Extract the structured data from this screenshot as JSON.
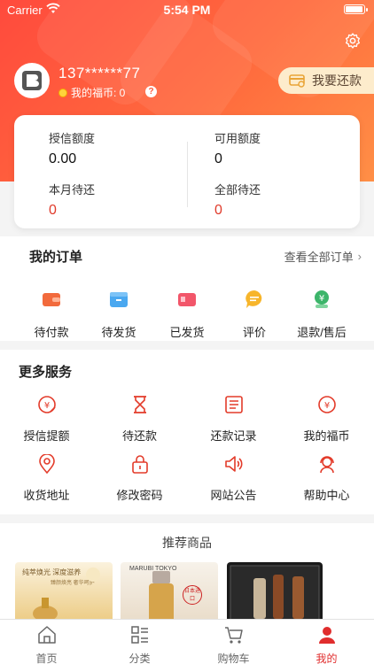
{
  "status_bar": {
    "carrier": "Carrier",
    "time": "5:54 PM"
  },
  "profile": {
    "phone": "137******77",
    "coins_label": "我的福币: 0",
    "help": "?"
  },
  "repay_button": "我要还款",
  "credit": {
    "credit_limit_label": "授信额度",
    "credit_limit_value": "0.00",
    "available_label": "可用额度",
    "available_value": "0",
    "month_due_label": "本月待还",
    "month_due_value": "0",
    "total_due_label": "全部待还",
    "total_due_value": "0"
  },
  "orders": {
    "title": "我的订单",
    "view_all": "查看全部订单",
    "items": [
      {
        "label": "待付款",
        "icon": "wallet-icon"
      },
      {
        "label": "待发货",
        "icon": "box-icon"
      },
      {
        "label": "已发货",
        "icon": "truck-icon"
      },
      {
        "label": "评价",
        "icon": "chat-icon"
      },
      {
        "label": "退款/售后",
        "icon": "refund-icon"
      }
    ]
  },
  "services": {
    "title": "更多服务",
    "items": [
      {
        "label": "授信提额",
        "icon": "credit-up-icon"
      },
      {
        "label": "待还款",
        "icon": "hourglass-icon"
      },
      {
        "label": "还款记录",
        "icon": "record-icon"
      },
      {
        "label": "我的福币",
        "icon": "yuan-coin-icon"
      },
      {
        "label": "收货地址",
        "icon": "location-icon"
      },
      {
        "label": "修改密码",
        "icon": "lock-icon"
      },
      {
        "label": "网站公告",
        "icon": "speaker-icon"
      },
      {
        "label": "帮助中心",
        "icon": "help-agent-icon"
      }
    ]
  },
  "recommend": {
    "title": "推荐商品",
    "p1_line1": "纯萃焕光 深度滋养",
    "p1_line2": "臻颜焕亮 奢华呵护",
    "p2_brand": "MARUBI TOKYO",
    "p2_stamp": "日本进口"
  },
  "tabbar": [
    {
      "label": "首页",
      "icon": "home-icon"
    },
    {
      "label": "分类",
      "icon": "category-icon"
    },
    {
      "label": "购物车",
      "icon": "cart-icon"
    },
    {
      "label": "我的",
      "icon": "user-icon"
    }
  ],
  "colors": {
    "accent": "#ff4a3d",
    "due_red": "#e03a2a",
    "tab_active": "#e02d2d"
  }
}
